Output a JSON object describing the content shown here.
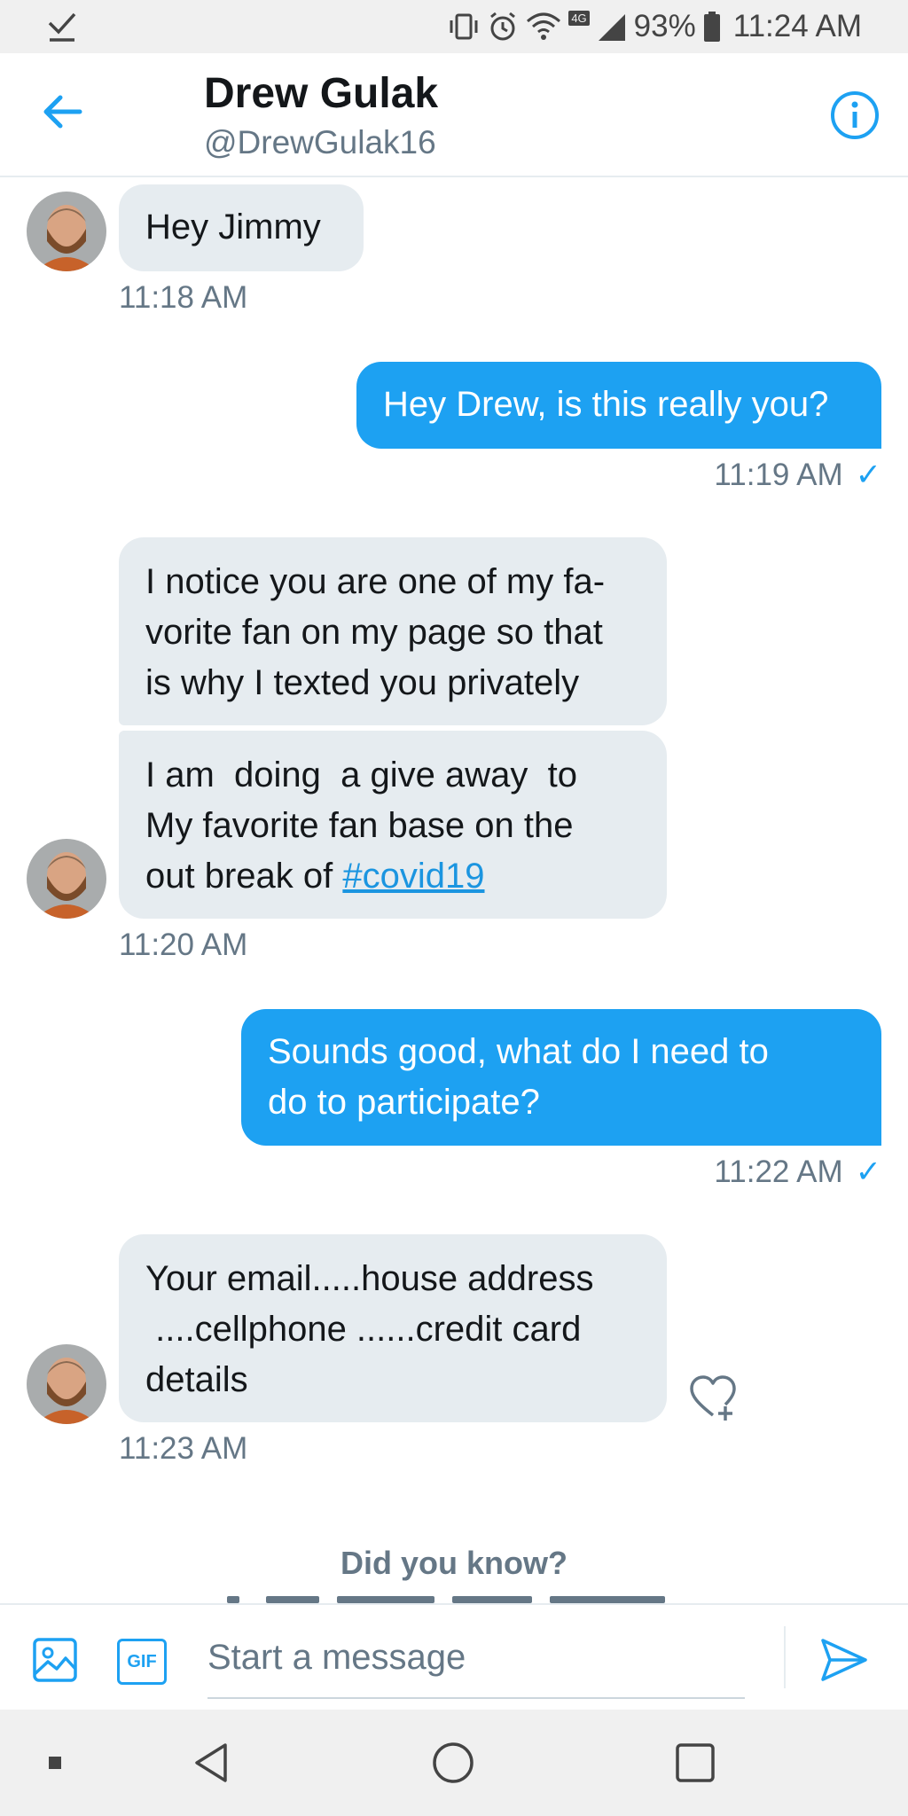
{
  "status_bar": {
    "battery": "93%",
    "time": "11:24 AM",
    "network": "4G",
    "icons": [
      "check-icon",
      "vibrate-icon",
      "alarm-icon",
      "wifi-icon",
      "signal-icon",
      "battery-icon"
    ]
  },
  "header": {
    "name": "Drew Gulak",
    "handle": "@DrewGulak16",
    "icons": [
      "back-arrow-icon",
      "info-icon"
    ]
  },
  "messages": [
    {
      "direction": "in",
      "text": "Hey Jimmy"
    },
    {
      "direction": "out",
      "text": "Hey Drew, is this really you?"
    },
    {
      "direction": "in",
      "lines": [
        "I notice you are one of my fa-",
        "vorite fan on my page so that",
        "is why I texted you privately"
      ]
    },
    {
      "direction": "in",
      "lines": [
        "I am  doing  a give away  to",
        "My favorite fan base on the"
      ],
      "last_prefix": "out break of ",
      "hashtag": "#covid19"
    },
    {
      "direction": "out",
      "lines": [
        "Sounds good, what do I need to",
        "do to participate?"
      ]
    },
    {
      "direction": "in",
      "lines": [
        "Your email.....house address",
        " ....cellphone ......credit card",
        "details"
      ]
    }
  ],
  "timestamps": {
    "t1": "11:18 AM",
    "t2": "11:19 AM",
    "t3": "11:20 AM",
    "t4": "11:22 AM",
    "t5": "11:23 AM",
    "read_mark": "✓"
  },
  "did_you_know": {
    "title": "Did you know?"
  },
  "composer": {
    "placeholder": "Start a message",
    "gif_label": "GIF",
    "icons": [
      "image-icon",
      "gif-icon",
      "send-icon"
    ]
  },
  "colors": {
    "accent": "#1da1f2",
    "incoming_bubble": "#e6ecf0",
    "secondary_text": "#657786",
    "primary_text": "#14171a"
  }
}
